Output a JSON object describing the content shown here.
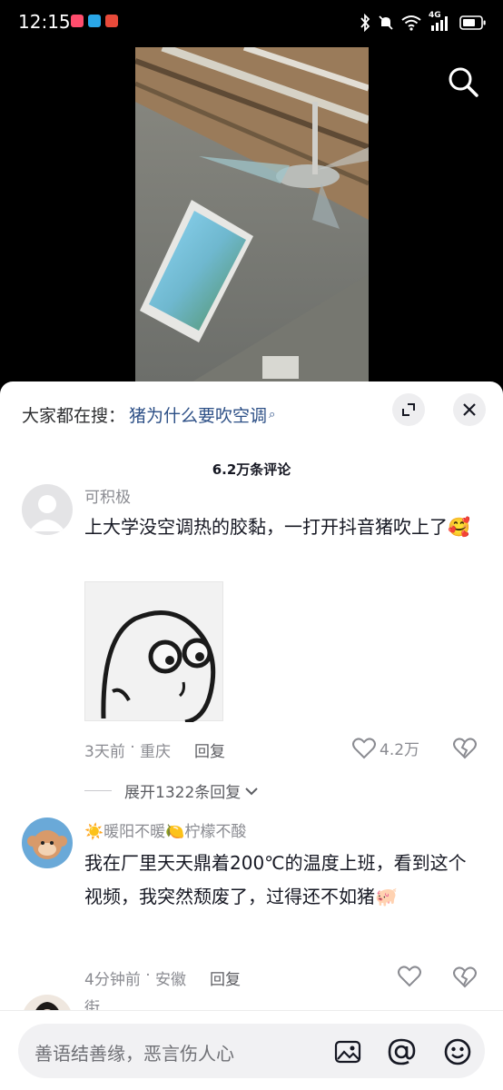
{
  "status_bar": {
    "time": "12:15",
    "network": "4G",
    "icons": [
      "bluetooth-icon",
      "mute-icon",
      "wifi-icon",
      "signal-icon",
      "battery-icon"
    ]
  },
  "video": {
    "search_icon": "search-icon"
  },
  "hot_search": {
    "label": "大家都在搜：",
    "query": "猪为什么要吹空调",
    "query_icon": "⌕"
  },
  "comments_title": "6.2万条评论",
  "comments": [
    {
      "username": "可积极",
      "text": "上大学没空调热的胶黏，一打开抖音猪吹上了🥰",
      "time": "3天前",
      "location": "重庆",
      "reply_label": "回复",
      "likes": "4.2万",
      "expand_label": "展开1322条回复",
      "has_sticker": true
    },
    {
      "username": "☀️暖阳不暖🍋柠檬不酸",
      "text": "我在厂里天天鼎着200℃的温度上班，看到这个视频，我突然颓废了，过得还不如猪🐖",
      "time": "4分钟前",
      "location": "安徽",
      "reply_label": "回复",
      "likes": ""
    },
    {
      "username": "街",
      "text": ""
    }
  ],
  "input": {
    "placeholder": "善语结善缘，恶言伤人心"
  },
  "colors": {
    "link_blue": "#2c4f86",
    "muted_gray": "#8a8b91",
    "text": "#161823"
  }
}
